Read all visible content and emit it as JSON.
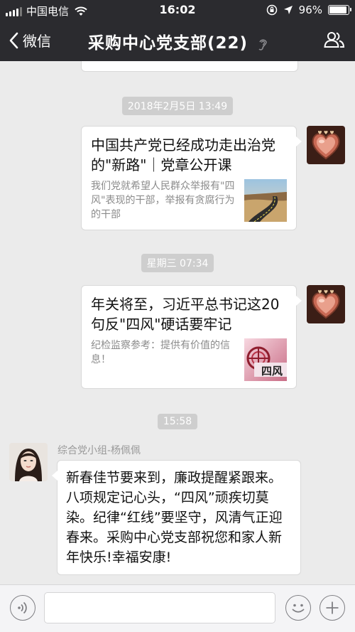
{
  "status_bar": {
    "carrier": "中国电信",
    "time": "16:02",
    "battery": "96%",
    "battery_level": 0.96
  },
  "nav": {
    "back_label": "微信",
    "title": "采购中心党支部(22)"
  },
  "messages": [
    {
      "timestamp": "2018年2月5日 13:49"
    },
    {
      "card": {
        "title": "中国共产党已经成功走出治党的\"新路\"｜党章公开课",
        "desc": "我们党就希望人民群众举报有\"四风\"表现的干部，举报有贪腐行为的干部"
      }
    },
    {
      "timestamp": "星期三 07:34"
    },
    {
      "card": {
        "title": "年关将至，习近平总书记这20句反\"四风\"硬话要牢记",
        "desc": "纪检监察参考：提供有价值的信息！",
        "thumb_text": "四风"
      }
    },
    {
      "timestamp": "15:58"
    },
    {
      "sender": "综合党小组-杨佩佩",
      "text": "新春佳节要来到，廉政提醒紧跟来。八项规定记心头，“四风”顽疾切莫染。纪律“红线”要坚守，风清气正迎春来。采购中心党支部祝您和家人新年快乐!幸福安康!"
    }
  ],
  "input_bar": {
    "placeholder": ""
  }
}
